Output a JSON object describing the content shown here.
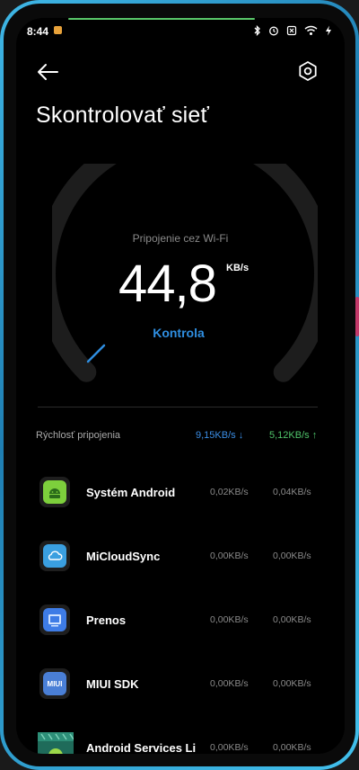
{
  "status": {
    "time": "8:44"
  },
  "header": {
    "title": "Skontrolovať sieť"
  },
  "gauge": {
    "connection_label": "Pripojenie cez Wi-Fi",
    "speed": "44,8",
    "unit": "KB/s",
    "action": "Kontrola"
  },
  "rates": {
    "label": "Rýchlosť pripojenia",
    "down": "9,15KB/s ↓",
    "up": "5,12KB/s ↑"
  },
  "apps": [
    {
      "name": "Systém Android",
      "down": "0,02KB/s",
      "up": "0,04KB/s"
    },
    {
      "name": "MiCloudSync",
      "down": "0,00KB/s",
      "up": "0,00KB/s"
    },
    {
      "name": "Prenos",
      "down": "0,00KB/s",
      "up": "0,00KB/s"
    },
    {
      "name": "MIUI SDK",
      "down": "0,00KB/s",
      "up": "0,00KB/s",
      "icon_text": "MIUI"
    },
    {
      "name": "Android Services Li",
      "down": "0,00KB/s",
      "up": "0,00KB/s"
    }
  ],
  "colors": {
    "accent_blue": "#2f8ee0",
    "upload_green": "#4fc36a",
    "frame": "#3fb7e6"
  }
}
